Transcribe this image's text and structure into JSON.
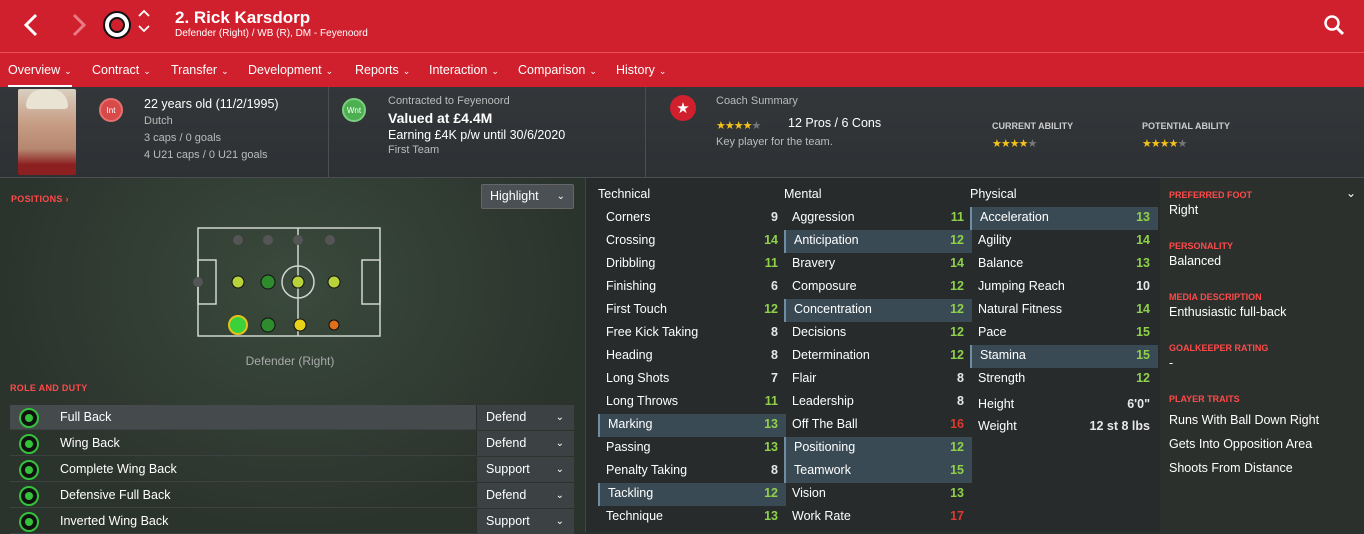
{
  "header": {
    "title": "2. Rick Karsdorp",
    "subtitle": "Defender (Right) / WB (R), DM - Feyenoord"
  },
  "tabs": [
    "Overview",
    "Contract",
    "Transfer",
    "Development",
    "Reports",
    "Interaction",
    "Comparison",
    "History"
  ],
  "profile": {
    "nation_code": "Int",
    "age": "22 years old (11/2/1995)",
    "nationality": "Dutch",
    "caps": "3 caps / 0 goals",
    "u21": "4 U21 caps / 0 U21 goals"
  },
  "contract": {
    "status_code": "Wnt",
    "contracted": "Contracted to Feyenoord",
    "value": "Valued at £4.4M",
    "earning": "Earning £4K p/w until 30/6/2020",
    "squad": "First Team"
  },
  "coach": {
    "title": "Coach Summary",
    "rating_stars": 4,
    "pros_cons": "12 Pros / 6 Cons",
    "summary": "Key player for the team.",
    "current_label": "CURRENT ABILITY",
    "current_stars": 4,
    "potential_label": "POTENTIAL ABILITY",
    "potential_stars": 4
  },
  "positions": {
    "label": "POSITIONS ›",
    "highlight": "Highlight",
    "position_name": "Defender (Right)"
  },
  "roles": {
    "label": "ROLE AND DUTY",
    "items": [
      {
        "name": "Full Back",
        "duty": "Defend"
      },
      {
        "name": "Wing Back",
        "duty": "Defend"
      },
      {
        "name": "Complete Wing Back",
        "duty": "Support"
      },
      {
        "name": "Defensive Full Back",
        "duty": "Defend"
      },
      {
        "name": "Inverted Wing Back",
        "duty": "Support"
      }
    ]
  },
  "attributes": {
    "technical_title": "Technical",
    "mental_title": "Mental",
    "physical_title": "Physical",
    "technical": [
      [
        "Corners",
        "9"
      ],
      [
        "Crossing",
        "14"
      ],
      [
        "Dribbling",
        "11"
      ],
      [
        "Finishing",
        "6"
      ],
      [
        "First Touch",
        "12"
      ],
      [
        "Free Kick Taking",
        "8"
      ],
      [
        "Heading",
        "8"
      ],
      [
        "Long Shots",
        "7"
      ],
      [
        "Long Throws",
        "11"
      ],
      [
        "Marking",
        "13"
      ],
      [
        "Passing",
        "13"
      ],
      [
        "Penalty Taking",
        "8"
      ],
      [
        "Tackling",
        "12"
      ],
      [
        "Technique",
        "13"
      ]
    ],
    "mental": [
      [
        "Aggression",
        "11"
      ],
      [
        "Anticipation",
        "12"
      ],
      [
        "Bravery",
        "14"
      ],
      [
        "Composure",
        "12"
      ],
      [
        "Concentration",
        "12"
      ],
      [
        "Decisions",
        "12"
      ],
      [
        "Determination",
        "12"
      ],
      [
        "Flair",
        "8"
      ],
      [
        "Leadership",
        "8"
      ],
      [
        "Off The Ball",
        "16"
      ],
      [
        "Positioning",
        "12"
      ],
      [
        "Teamwork",
        "15"
      ],
      [
        "Vision",
        "13"
      ],
      [
        "Work Rate",
        "17"
      ]
    ],
    "physical": [
      [
        "Acceleration",
        "13"
      ],
      [
        "Agility",
        "14"
      ],
      [
        "Balance",
        "13"
      ],
      [
        "Jumping Reach",
        "10"
      ],
      [
        "Natural Fitness",
        "14"
      ],
      [
        "Pace",
        "15"
      ],
      [
        "Stamina",
        "15"
      ],
      [
        "Strength",
        "12"
      ]
    ],
    "height_label": "Height",
    "height": "6'0\"",
    "weight_label": "Weight",
    "weight": "12 st 8 lbs"
  },
  "info": {
    "foot_label": "PREFERRED FOOT",
    "foot": "Right",
    "personality_label": "PERSONALITY",
    "personality": "Balanced",
    "media_label": "MEDIA DESCRIPTION",
    "media": "Enthusiastic full-back",
    "gk_label": "GOALKEEPER RATING",
    "gk": "-",
    "traits_label": "PLAYER TRAITS",
    "traits": [
      "Runs With Ball Down Right",
      "Gets Into Opposition Area",
      "Shoots From Distance"
    ]
  },
  "colors": {
    "brand": "#d0202d",
    "good": "#8fd14a",
    "bad": "#e03a2c",
    "star": "#f4c21a"
  }
}
